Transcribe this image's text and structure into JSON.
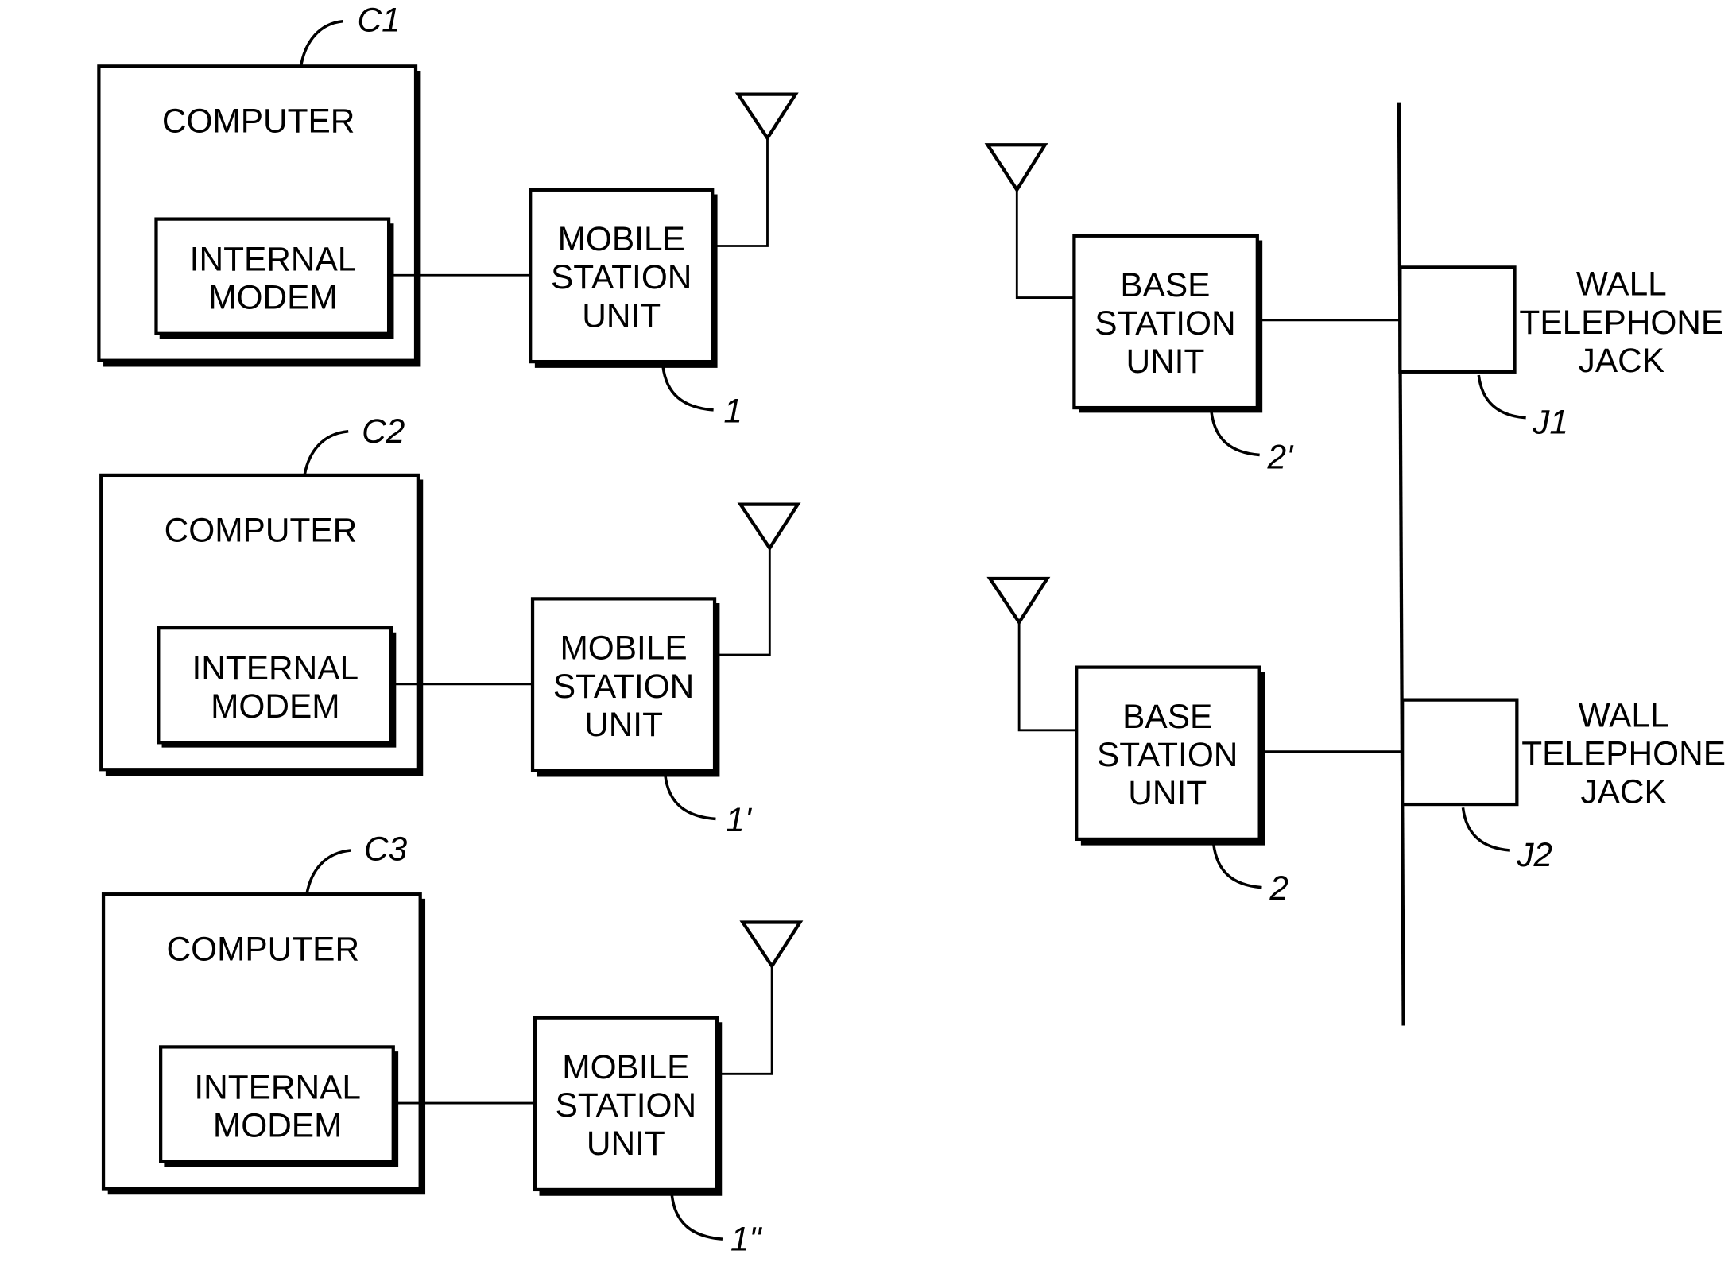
{
  "diagram": {
    "computers": [
      {
        "ref": "C1",
        "label": "COMPUTER",
        "modem": [
          "INTERNAL",
          "MODEM"
        ],
        "mobile": [
          "MOBILE",
          "STATION",
          "UNIT"
        ],
        "mobile_ref": "1"
      },
      {
        "ref": "C2",
        "label": "COMPUTER",
        "modem": [
          "INTERNAL",
          "MODEM"
        ],
        "mobile": [
          "MOBILE",
          "STATION",
          "UNIT"
        ],
        "mobile_ref": "1'"
      },
      {
        "ref": "C3",
        "label": "COMPUTER",
        "modem": [
          "INTERNAL",
          "MODEM"
        ],
        "mobile": [
          "MOBILE",
          "STATION",
          "UNIT"
        ],
        "mobile_ref": "1\""
      }
    ],
    "base_stations": [
      {
        "label": [
          "BASE",
          "STATION",
          "UNIT"
        ],
        "ref": "2'",
        "jack_label": [
          "WALL",
          "TELEPHONE",
          "JACK"
        ],
        "jack_ref": "J1"
      },
      {
        "label": [
          "BASE",
          "STATION",
          "UNIT"
        ],
        "ref": "2",
        "jack_label": [
          "WALL",
          "TELEPHONE",
          "JACK"
        ],
        "jack_ref": "J2"
      }
    ]
  }
}
